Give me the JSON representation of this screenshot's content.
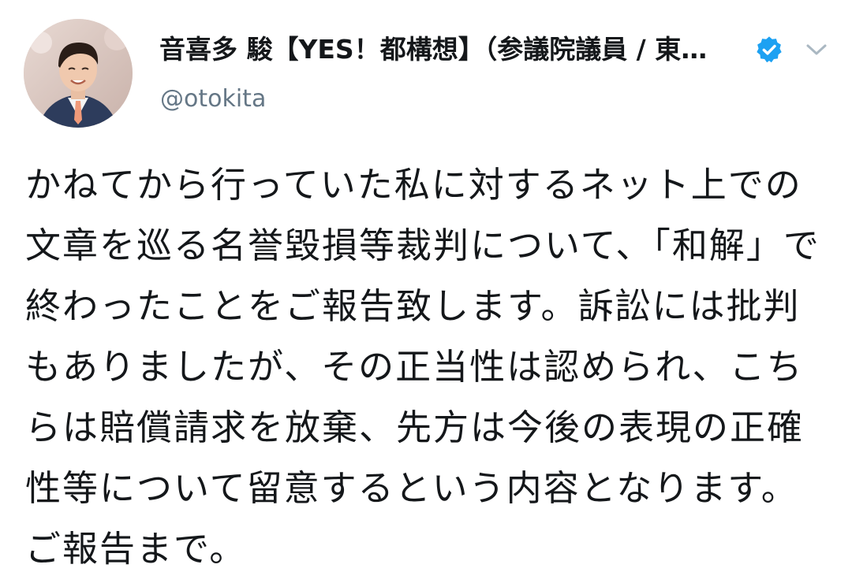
{
  "tweet": {
    "display_name": "音喜多 駿【YES！都構想】（参議院議員 / 東…",
    "handle": "@otokita",
    "verified": true,
    "body": "かねてから行っていた私に対するネット上での文章を巡る名誉毀損等裁判について、「和解」で終わったことをご報告致します。訴訟には批判もありましたが、その正当性は認められ、こちらは賠償請求を放棄、先方は今後の表現の正確性等について留意するという内容となります。ご報告まで。"
  },
  "icons": {
    "verified": "verified-badge-icon",
    "menu": "chevron-down-icon",
    "avatar": "profile-avatar"
  },
  "colors": {
    "verified_blue": "#1da1f2",
    "text_primary": "#14171a",
    "text_secondary": "#657786",
    "caret": "#aab8c2"
  }
}
